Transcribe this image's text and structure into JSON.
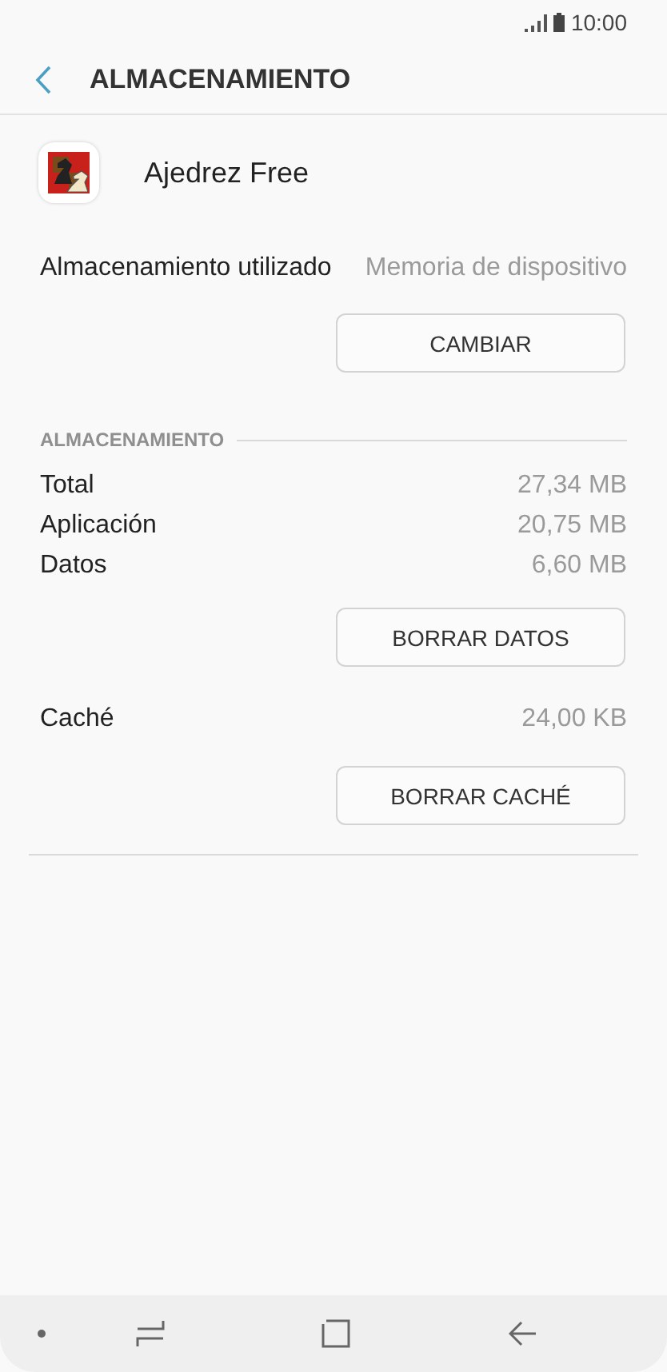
{
  "status_bar": {
    "time": "10:00"
  },
  "header": {
    "title": "ALMACENAMIENTO"
  },
  "app": {
    "name": "Ajedrez Free"
  },
  "storage_used": {
    "label": "Almacenamiento utilizado",
    "value": "Memoria de dispositivo"
  },
  "change_button": "CAMBIAR",
  "section": {
    "title": "ALMACENAMIENTO",
    "rows": [
      {
        "label": "Total",
        "value": "27,34 MB"
      },
      {
        "label": "Aplicación",
        "value": "20,75 MB"
      },
      {
        "label": "Datos",
        "value": "6,60 MB"
      }
    ]
  },
  "clear_data_button": "BORRAR DATOS",
  "cache": {
    "label": "Caché",
    "value": "24,00 KB"
  },
  "clear_cache_button": "BORRAR CACHÉ"
}
